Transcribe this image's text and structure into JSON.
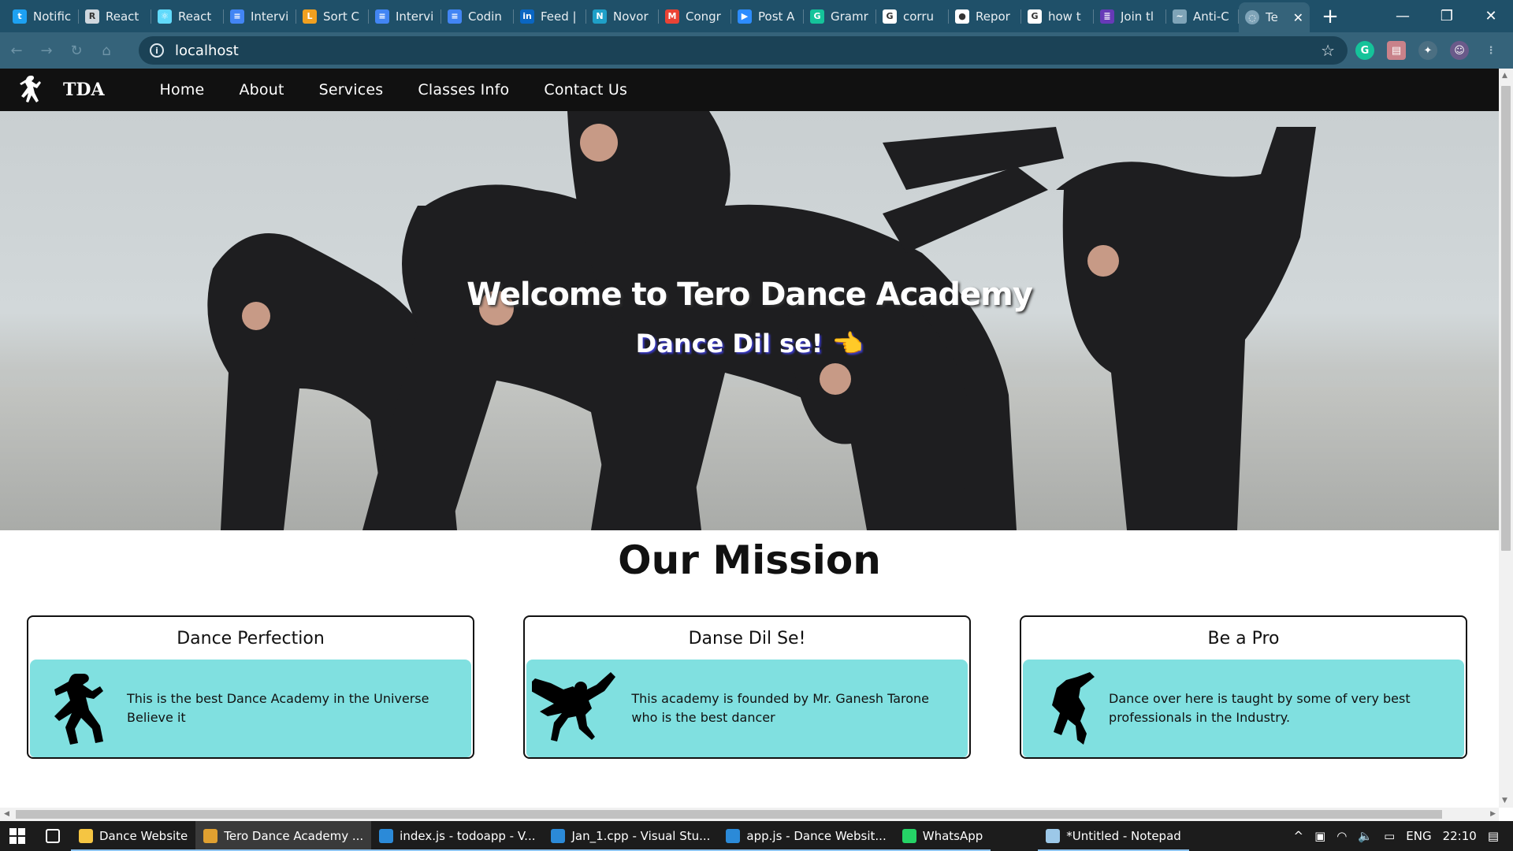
{
  "browser": {
    "tabs": [
      {
        "label": "Notific",
        "icon": "twitter-icon",
        "color": "#1da1f2",
        "glyph": "t"
      },
      {
        "label": "React",
        "icon": "react-router-icon",
        "color": "#cfd7de",
        "glyph": "R"
      },
      {
        "label": "React",
        "icon": "react-icon",
        "color": "#61dafb",
        "glyph": "⚛"
      },
      {
        "label": "Intervi",
        "icon": "google-docs-icon",
        "color": "#4285f4",
        "glyph": "≡"
      },
      {
        "label": "Sort C",
        "icon": "leetcode-icon",
        "color": "#f0a020",
        "glyph": "L"
      },
      {
        "label": "Intervi",
        "icon": "google-docs-icon",
        "color": "#4285f4",
        "glyph": "≡"
      },
      {
        "label": "Codin",
        "icon": "google-docs-icon",
        "color": "#4285f4",
        "glyph": "≡"
      },
      {
        "label": "Feed |",
        "icon": "linkedin-icon",
        "color": "#0a66c2",
        "glyph": "in"
      },
      {
        "label": "Novor",
        "icon": "novoresume-icon",
        "color": "#1fa0c8",
        "glyph": "N"
      },
      {
        "label": "Congr",
        "icon": "gmail-icon",
        "color": "#ea4335",
        "glyph": "M"
      },
      {
        "label": "Post A",
        "icon": "zoom-icon",
        "color": "#2d8cff",
        "glyph": "▶"
      },
      {
        "label": "Gramr",
        "icon": "grammarly-icon",
        "color": "#15c39a",
        "glyph": "G"
      },
      {
        "label": "corru",
        "icon": "google-icon",
        "color": "#ffffff",
        "glyph": "G"
      },
      {
        "label": "Repor",
        "icon": "github-icon",
        "color": "#ffffff",
        "glyph": "●"
      },
      {
        "label": "how t",
        "icon": "google-icon",
        "color": "#ffffff",
        "glyph": "G"
      },
      {
        "label": "Join tl",
        "icon": "forms-icon",
        "color": "#673ab7",
        "glyph": "≣"
      },
      {
        "label": "Anti-C",
        "icon": "loading-icon",
        "color": "#7fa4b8",
        "glyph": "~"
      }
    ],
    "active_tab": {
      "label": "Te",
      "icon": "globe-icon"
    },
    "url": "localhost",
    "extension_colors": [
      "#15c39a",
      "#f0a7a7",
      "#8a8a8a"
    ]
  },
  "site": {
    "brand": "TDA",
    "nav": [
      "Home",
      "About",
      "Services",
      "Classes Info",
      "Contact Us"
    ],
    "hero_title": "Welcome to Tero Dance Academy",
    "hero_subtitle": "Dance Dil se! 👈",
    "mission_title": "Our Mission",
    "cards": [
      {
        "title": "Dance Perfection",
        "text": "This is the best Dance Academy in the Universe Believe it",
        "icon": "dancer-silhouette-icon"
      },
      {
        "title": "Danse Dil Se!",
        "text": "This academy is founded by Mr. Ganesh Tarone who is the best dancer",
        "icon": "breakdancer-silhouette-icon"
      },
      {
        "title": "Be a Pro",
        "text": "Dance over here is taught by some of very best professionals in the Industry.",
        "icon": "jumping-dancer-icon"
      }
    ]
  },
  "taskbar": {
    "items": [
      {
        "label": "Dance Website",
        "icon": "folder-icon",
        "color": "#f5c542"
      },
      {
        "label": "Tero Dance Academy ...",
        "icon": "chrome-icon",
        "color": "#e0a030"
      },
      {
        "label": "index.js - todoapp - V...",
        "icon": "vscode-icon",
        "color": "#2b8ad8"
      },
      {
        "label": "Jan_1.cpp - Visual Stu...",
        "icon": "vscode-icon",
        "color": "#2b8ad8"
      },
      {
        "label": "app.js - Dance Websit...",
        "icon": "vscode-icon",
        "color": "#2b8ad8"
      },
      {
        "label": "WhatsApp",
        "icon": "whatsapp-icon",
        "color": "#25d366"
      },
      {
        "label": "*Untitled - Notepad",
        "icon": "notepad-icon",
        "color": "#9cc8e8"
      }
    ],
    "tray_language": "ENG",
    "time": "22:10"
  }
}
